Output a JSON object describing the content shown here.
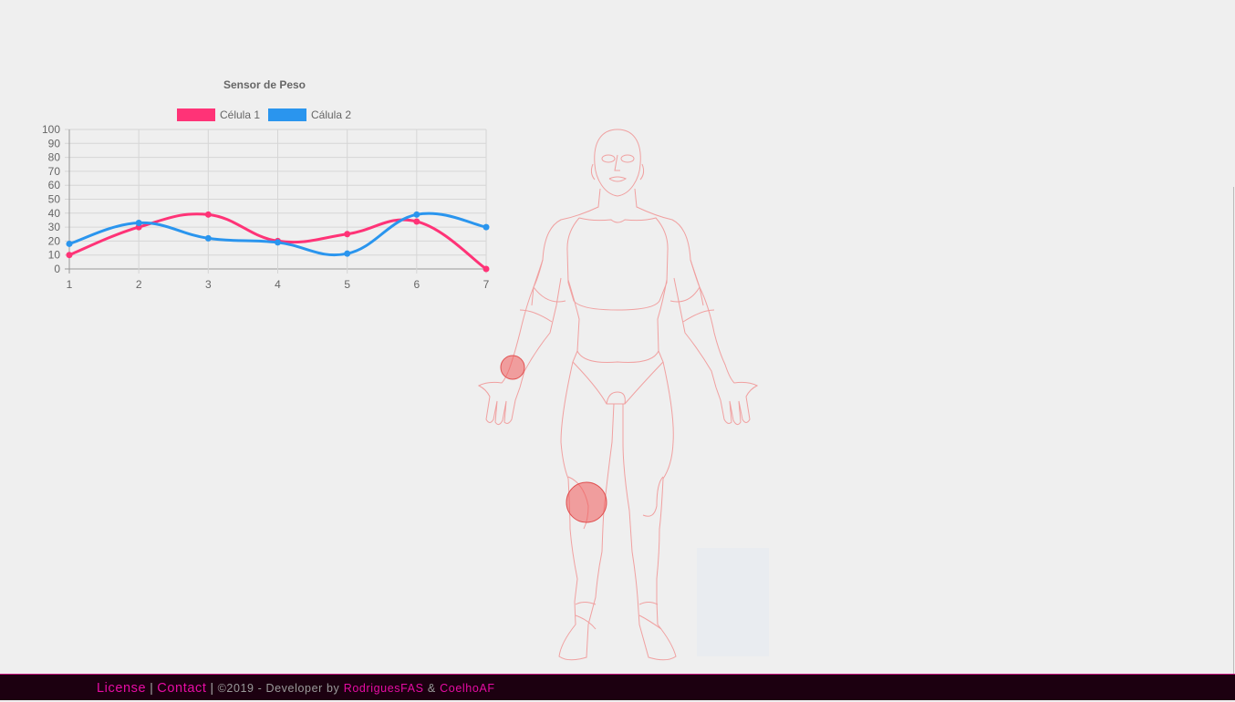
{
  "chart_data": {
    "type": "line",
    "title": "Sensor de Peso",
    "categories": [
      "1",
      "2",
      "3",
      "4",
      "5",
      "6",
      "7"
    ],
    "series": [
      {
        "name": "Célula 1",
        "color": "#ff3377",
        "values": [
          10,
          30,
          39,
          20,
          25,
          34,
          0
        ]
      },
      {
        "name": "Cálula 2",
        "color": "#2a95ee",
        "values": [
          18,
          33,
          22,
          19,
          11,
          39,
          30
        ]
      }
    ],
    "ylim": [
      0,
      100
    ],
    "yticks": [
      "0",
      "10",
      "20",
      "30",
      "40",
      "50",
      "60",
      "70",
      "80",
      "90",
      "100"
    ],
    "grid": true,
    "legend": "top"
  },
  "footer": {
    "license": "License",
    "contact": "Contact",
    "separator": "|",
    "copyright": "©2019 - Developer by",
    "author1": "RodriguesFAS",
    "amp": "&",
    "author2": "CoelhoAF"
  }
}
